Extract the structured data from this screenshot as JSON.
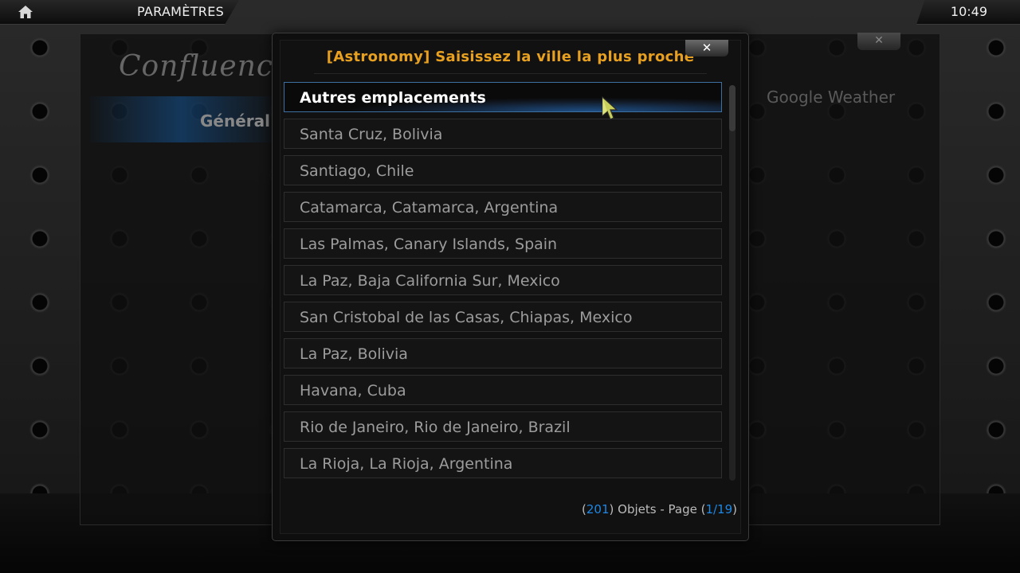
{
  "topbar": {
    "title": "PARAMÈTRES",
    "clock": "10:49"
  },
  "settings_window": {
    "logo": "Confluence",
    "category": "Général",
    "addon_name": "Google Weather",
    "close_glyph": "✕"
  },
  "dialog": {
    "heading": "[Astronomy] Saisissez la ville la plus proche",
    "close_glyph": "✕",
    "items": [
      {
        "label": "Autres emplacements",
        "focused": true
      },
      {
        "label": "Santa Cruz, Bolivia"
      },
      {
        "label": "Santiago, Chile"
      },
      {
        "label": "Catamarca, Catamarca, Argentina"
      },
      {
        "label": "Las Palmas, Canary Islands, Spain"
      },
      {
        "label": "La Paz, Baja California Sur, Mexico"
      },
      {
        "label": "San Cristobal de las Casas, Chiapas, Mexico"
      },
      {
        "label": "La Paz, Bolivia"
      },
      {
        "label": "Havana, Cuba"
      },
      {
        "label": "Rio de Janeiro, Rio de Janeiro, Brazil"
      },
      {
        "label": "La Rioja, La Rioja, Argentina"
      }
    ],
    "footer": {
      "open_paren": "(",
      "count": "201",
      "objects_text": ") Objets - Page (",
      "page": "1/19",
      "close_paren": ")"
    }
  },
  "colors": {
    "heading": "#e8a020",
    "accent_blue": "#1e88e5",
    "focus_glow": "#2882e6"
  },
  "icons": {
    "home": "home-icon",
    "close": "close-icon",
    "cursor": "pointer-cursor-icon"
  }
}
